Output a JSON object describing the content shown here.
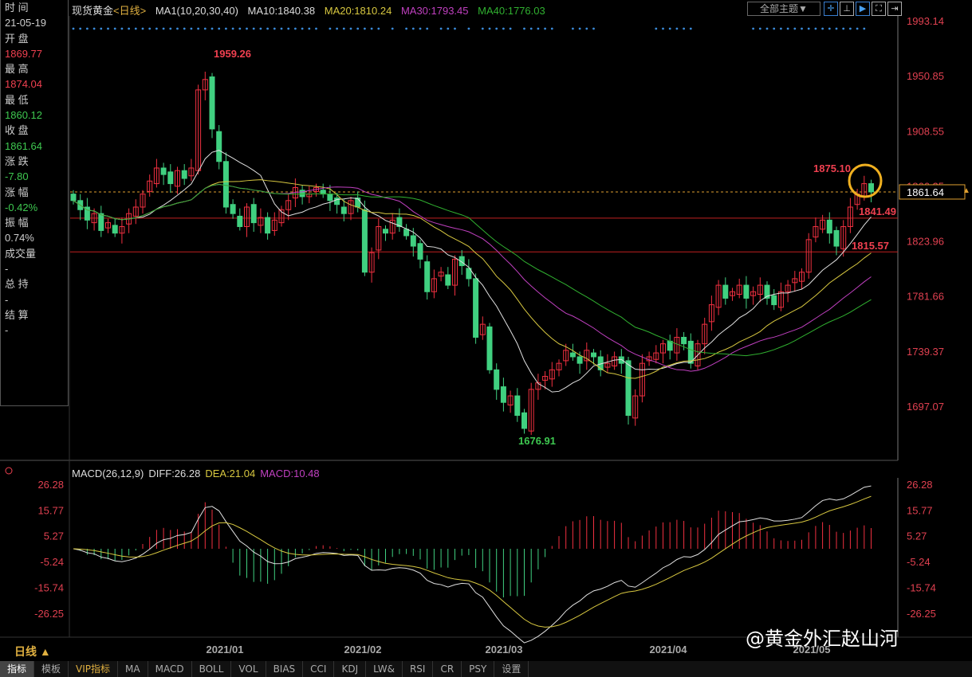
{
  "header": {
    "symbol": "现货黄金",
    "period": "<日线>",
    "ma_label": "MA1(10,20,30,40)",
    "ma10": "MA10:1840.38",
    "ma20": "MA20:1810.24",
    "ma30": "MA30:1793.45",
    "ma40": "MA40:1776.03",
    "theme": "全部主题▼"
  },
  "info_panel": [
    {
      "label": "时 间",
      "value": "21-05-19",
      "cls": "lbl"
    },
    {
      "label": "开 盘",
      "value": "1869.77",
      "cls": "red"
    },
    {
      "label": "最 高",
      "value": "1874.04",
      "cls": "red"
    },
    {
      "label": "最 低",
      "value": "1860.12",
      "cls": "green"
    },
    {
      "label": "收 盘",
      "value": "1861.64",
      "cls": "green"
    },
    {
      "label": "涨 跌",
      "value": "-7.80",
      "cls": "green"
    },
    {
      "label": "涨 幅",
      "value": "-0.42%",
      "cls": "green"
    },
    {
      "label": "振 幅",
      "value": "0.74%",
      "cls": "lbl"
    },
    {
      "label": "成交量",
      "value": "-",
      "cls": "lbl"
    },
    {
      "label": "总 持",
      "value": "-",
      "cls": "lbl"
    },
    {
      "label": "结 算",
      "value": "-",
      "cls": "lbl"
    }
  ],
  "macd_header": {
    "name": "MACD(26,12,9)",
    "diff": "DIFF:26.28",
    "dea": "DEA:21.04",
    "macd": "MACD:10.48"
  },
  "period_button": "日线 ▲",
  "watermark": "@黄金外汇赵山河",
  "tabs": [
    "指标",
    "模板",
    "VIP指标",
    "MA",
    "MACD",
    "BOLL",
    "VOL",
    "BIAS",
    "CCI",
    "KDJ",
    "LW&",
    "RSI",
    "CR",
    "PSY",
    "设置"
  ],
  "colors": {
    "up": "#f03040",
    "down": "#40d080",
    "ma10": "#e0e0e0",
    "ma20": "#d8c840",
    "ma30": "#c040c0",
    "ma40": "#30b030"
  },
  "chart_data": [
    {
      "type": "candlestick",
      "title": "现货黄金 日线",
      "price_ticks": [
        "1993.14",
        "1950.85",
        "1908.55",
        "1866.25",
        "1823.96",
        "1781.66",
        "1739.37",
        "1697.07"
      ],
      "ylim": [
        1655,
        1993.14
      ],
      "x_ticks": [
        "2021/01",
        "2021/02",
        "2021/03",
        "2021/04",
        "2021/05"
      ],
      "last_price": "1861.64",
      "annotations": [
        "1959.26",
        "1676.91",
        "1875.10",
        "1841.49",
        "1815.57"
      ],
      "hlines": [
        1841.49,
        1815.57
      ],
      "closes": [
        1855,
        1848,
        1840,
        1845,
        1832,
        1838,
        1830,
        1835,
        1845,
        1850,
        1860,
        1870,
        1880,
        1875,
        1868,
        1878,
        1872,
        1880,
        1940,
        1948,
        1910,
        1885,
        1850,
        1845,
        1835,
        1850,
        1838,
        1842,
        1830,
        1840,
        1848,
        1855,
        1865,
        1858,
        1860,
        1865,
        1860,
        1855,
        1852,
        1845,
        1855,
        1850,
        1800,
        1815,
        1835,
        1830,
        1840,
        1835,
        1828,
        1820,
        1810,
        1785,
        1795,
        1800,
        1790,
        1810,
        1805,
        1795,
        1750,
        1760,
        1725,
        1710,
        1700,
        1705,
        1690,
        1680,
        1710,
        1715,
        1720,
        1725,
        1730,
        1740,
        1735,
        1730,
        1740,
        1735,
        1725,
        1730,
        1735,
        1730,
        1690,
        1705,
        1730,
        1735,
        1738,
        1745,
        1740,
        1750,
        1745,
        1730,
        1745,
        1760,
        1775,
        1790,
        1780,
        1785,
        1790,
        1780,
        1785,
        1790,
        1780,
        1775,
        1785,
        1790,
        1795,
        1800,
        1825,
        1835,
        1840,
        1830,
        1820,
        1835,
        1850,
        1860,
        1868,
        1861.64
      ]
    },
    {
      "type": "macd",
      "ticks": [
        "26.28",
        "15.77",
        "5.27",
        "-5.24",
        "-15.74",
        "-26.25"
      ],
      "ylim": [
        -31,
        31
      ]
    }
  ]
}
